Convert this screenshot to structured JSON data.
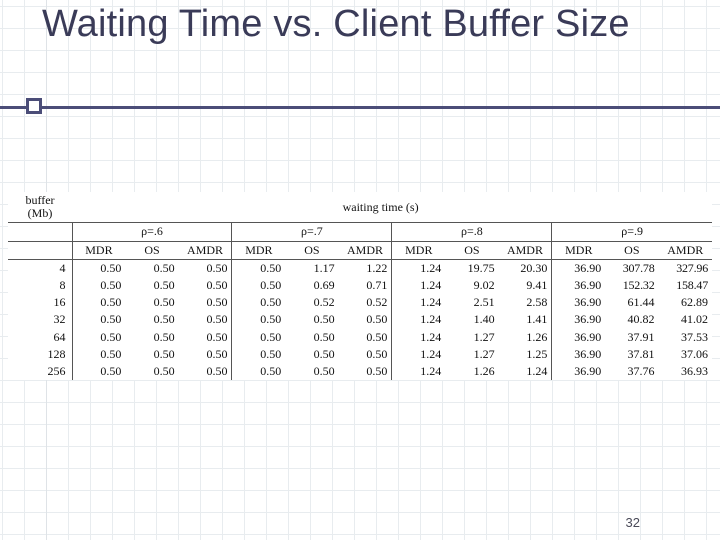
{
  "title": "Waiting Time vs. Client Buffer Size",
  "page_number": "32",
  "headers": {
    "buffer": "buffer (Mb)",
    "waiting": "waiting time (s)",
    "rho": [
      "ρ=.6",
      "ρ=.7",
      "ρ=.8",
      "ρ=.9"
    ],
    "methods": [
      "MDR",
      "OS",
      "AMDR"
    ]
  },
  "buffers": [
    "4",
    "8",
    "16",
    "32",
    "64",
    "128",
    "256"
  ],
  "values": {
    "rho06": {
      "MDR": [
        "0.50",
        "0.50",
        "0.50",
        "0.50",
        "0.50",
        "0.50",
        "0.50"
      ],
      "OS": [
        "0.50",
        "0.50",
        "0.50",
        "0.50",
        "0.50",
        "0.50",
        "0.50"
      ],
      "AMDR": [
        "0.50",
        "0.50",
        "0.50",
        "0.50",
        "0.50",
        "0.50",
        "0.50"
      ]
    },
    "rho07": {
      "MDR": [
        "0.50",
        "0.50",
        "0.50",
        "0.50",
        "0.50",
        "0.50",
        "0.50"
      ],
      "OS": [
        "1.17",
        "0.69",
        "0.52",
        "0.50",
        "0.50",
        "0.50",
        "0.50"
      ],
      "AMDR": [
        "1.22",
        "0.71",
        "0.52",
        "0.50",
        "0.50",
        "0.50",
        "0.50"
      ]
    },
    "rho08": {
      "MDR": [
        "1.24",
        "1.24",
        "1.24",
        "1.24",
        "1.24",
        "1.24",
        "1.24"
      ],
      "OS": [
        "19.75",
        "9.02",
        "2.51",
        "1.40",
        "1.27",
        "1.27",
        "1.26"
      ],
      "AMDR": [
        "20.30",
        "9.41",
        "2.58",
        "1.41",
        "1.26",
        "1.25",
        "1.24"
      ]
    },
    "rho09": {
      "MDR": [
        "36.90",
        "36.90",
        "36.90",
        "36.90",
        "36.90",
        "36.90",
        "36.90"
      ],
      "OS": [
        "307.78",
        "152.32",
        "61.44",
        "40.82",
        "37.91",
        "37.81",
        "37.76"
      ],
      "AMDR": [
        "327.96",
        "158.47",
        "62.89",
        "41.02",
        "37.53",
        "37.06",
        "36.93"
      ]
    }
  },
  "chart_data": {
    "type": "table",
    "title": "Waiting Time vs. Client Buffer Size",
    "row_label": "buffer (Mb)",
    "col_groups": [
      "ρ=.6",
      "ρ=.7",
      "ρ=.8",
      "ρ=.9"
    ],
    "sub_cols": [
      "MDR",
      "OS",
      "AMDR"
    ],
    "rows": [
      4,
      8,
      16,
      32,
      64,
      128,
      256
    ],
    "series": [
      {
        "name": "ρ=.6 MDR",
        "values": [
          0.5,
          0.5,
          0.5,
          0.5,
          0.5,
          0.5,
          0.5
        ]
      },
      {
        "name": "ρ=.6 OS",
        "values": [
          0.5,
          0.5,
          0.5,
          0.5,
          0.5,
          0.5,
          0.5
        ]
      },
      {
        "name": "ρ=.6 AMDR",
        "values": [
          0.5,
          0.5,
          0.5,
          0.5,
          0.5,
          0.5,
          0.5
        ]
      },
      {
        "name": "ρ=.7 MDR",
        "values": [
          0.5,
          0.5,
          0.5,
          0.5,
          0.5,
          0.5,
          0.5
        ]
      },
      {
        "name": "ρ=.7 OS",
        "values": [
          1.17,
          0.69,
          0.52,
          0.5,
          0.5,
          0.5,
          0.5
        ]
      },
      {
        "name": "ρ=.7 AMDR",
        "values": [
          1.22,
          0.71,
          0.52,
          0.5,
          0.5,
          0.5,
          0.5
        ]
      },
      {
        "name": "ρ=.8 MDR",
        "values": [
          1.24,
          1.24,
          1.24,
          1.24,
          1.24,
          1.24,
          1.24
        ]
      },
      {
        "name": "ρ=.8 OS",
        "values": [
          19.75,
          9.02,
          2.51,
          1.4,
          1.27,
          1.27,
          1.26
        ]
      },
      {
        "name": "ρ=.8 AMDR",
        "values": [
          20.3,
          9.41,
          2.58,
          1.41,
          1.26,
          1.25,
          1.24
        ]
      },
      {
        "name": "ρ=.9 MDR",
        "values": [
          36.9,
          36.9,
          36.9,
          36.9,
          36.9,
          36.9,
          36.9
        ]
      },
      {
        "name": "ρ=.9 OS",
        "values": [
          307.78,
          152.32,
          61.44,
          40.82,
          37.91,
          37.81,
          37.76
        ]
      },
      {
        "name": "ρ=.9 AMDR",
        "values": [
          327.96,
          158.47,
          62.89,
          41.02,
          37.53,
          37.06,
          36.93
        ]
      }
    ]
  }
}
